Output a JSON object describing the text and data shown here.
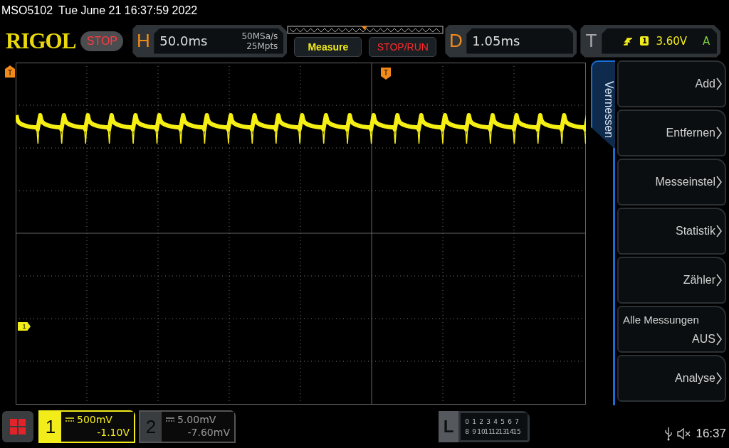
{
  "status_bar": {
    "model": "MSO5102",
    "datetime": "Tue June 21 16:37:59 2022"
  },
  "header": {
    "logo": "RIGOL",
    "run_state": "STOP",
    "horizontal": {
      "label": "H",
      "timebase": "50.0ms",
      "sample_rate": "50MSa/s",
      "memory_depth": "25Mpts"
    },
    "buttons": [
      {
        "label": "Measure",
        "kind": "measure"
      },
      {
        "label": "STOP/RUN",
        "kind": "run"
      }
    ],
    "delay": {
      "label": "D",
      "value": "1.05ms"
    },
    "trigger": {
      "label": "T",
      "source": "1",
      "level": "3.60V",
      "mode": "A"
    }
  },
  "display": {
    "markers": [
      {
        "label": "T",
        "kind": "trigger-level"
      },
      {
        "label": "T",
        "kind": "trigger-position"
      },
      {
        "label": "1",
        "kind": "channel"
      }
    ]
  },
  "menu": {
    "title": "Vermessen",
    "items": [
      {
        "label": "Add"
      },
      {
        "label": "Entfernen"
      },
      {
        "label": "Messeinstel"
      },
      {
        "label": "Statistik"
      },
      {
        "label": "Zähler"
      },
      {
        "caption": "Alle Messungen",
        "label": "AUS"
      },
      {
        "label": "Analyse"
      }
    ]
  },
  "channels": [
    {
      "number": "1",
      "scale": "500mV",
      "offset": "-1.10V",
      "on": true
    },
    {
      "number": "2",
      "scale": "5.00mV",
      "offset": "-7.60mV",
      "on": false
    }
  ],
  "logic": {
    "label": "L",
    "rows": [
      [
        "0",
        "1",
        "2",
        "3",
        "4",
        "5",
        "6",
        "7"
      ],
      [
        "8",
        "9",
        "10",
        "11",
        "12",
        "13",
        "14",
        "15"
      ]
    ]
  },
  "tray": {
    "time": "16:37"
  }
}
